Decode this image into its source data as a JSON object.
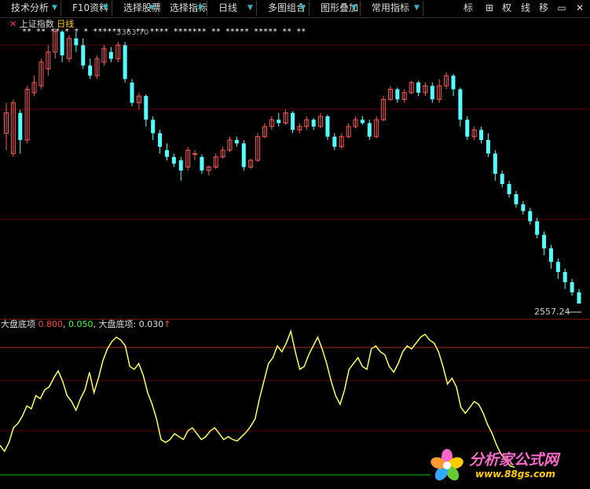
{
  "toolbar": {
    "items": [
      {
        "label": "技术分析",
        "arrow": true
      },
      {
        "label": "F10资料",
        "arrow": false
      },
      {
        "label": "选择股票",
        "arrow": false
      },
      {
        "label": "选择指标",
        "arrow": false
      },
      {
        "label": "日线",
        "arrow": true
      },
      {
        "label": "多图组合",
        "arrow": true
      },
      {
        "label": "图形叠加",
        "arrow": false
      },
      {
        "label": "常用指标",
        "arrow": true
      }
    ],
    "right_buttons": [
      "标",
      "权",
      "线",
      "移"
    ]
  },
  "main_panel": {
    "index_name": "上证指数",
    "period": "日线",
    "high_label": "3363.70",
    "low_label": "2557.24"
  },
  "sub_panel": {
    "indicator_name": "大盘底项",
    "level_high": "0.800",
    "level_low": "0.050",
    "value_label": "大盘底项",
    "value": "0.030"
  },
  "watermark": {
    "brand": "分析家公式网",
    "url": "www.88gs.com"
  },
  "colors": {
    "up": "#ff5555",
    "down": "#54ffff",
    "indicator": "#ffff55",
    "ref_red": "#a52a2a",
    "ref_green": "#00cc00",
    "accent_text_red": "#ff4444",
    "accent_text_green": "#44ff44"
  },
  "chart_data": [
    {
      "type": "candlestick",
      "title": "上证指数 日线",
      "ylim": [
        2520,
        3370
      ],
      "candles": [
        [
          3060,
          3120,
          3010,
          3150
        ],
        [
          3000,
          3150,
          2990,
          3160
        ],
        [
          3120,
          3040,
          3000,
          3130
        ],
        [
          3040,
          3190,
          3030,
          3200
        ],
        [
          3180,
          3210,
          3170,
          3230
        ],
        [
          3200,
          3270,
          3190,
          3280
        ],
        [
          3250,
          3300,
          3230,
          3320
        ],
        [
          3300,
          3360,
          3280,
          3370
        ],
        [
          3360,
          3290,
          3270,
          3365
        ],
        [
          3280,
          3340,
          3270,
          3350
        ],
        [
          3340,
          3320,
          3300,
          3360
        ],
        [
          3320,
          3260,
          3250,
          3340
        ],
        [
          3260,
          3230,
          3220,
          3280
        ],
        [
          3230,
          3280,
          3220,
          3290
        ],
        [
          3270,
          3310,
          3260,
          3320
        ],
        [
          3300,
          3280,
          3270,
          3315
        ],
        [
          3280,
          3320,
          3270,
          3330
        ],
        [
          3320,
          3220,
          3210,
          3330
        ],
        [
          3210,
          3150,
          3140,
          3220
        ],
        [
          3150,
          3170,
          3130,
          3180
        ],
        [
          3170,
          3100,
          3080,
          3175
        ],
        [
          3100,
          3060,
          3040,
          3110
        ],
        [
          3060,
          3020,
          3000,
          3070
        ],
        [
          3010,
          2990,
          2980,
          3030
        ],
        [
          2990,
          2970,
          2960,
          3000
        ],
        [
          2980,
          2950,
          2920,
          2990
        ],
        [
          2960,
          3010,
          2950,
          3020
        ],
        [
          3000,
          3000,
          2980,
          3010
        ],
        [
          2990,
          2950,
          2940,
          2998
        ],
        [
          2950,
          2960,
          2935,
          2965
        ],
        [
          2960,
          2990,
          2955,
          3000
        ],
        [
          2990,
          3010,
          2985,
          3020
        ],
        [
          3010,
          3040,
          3005,
          3050
        ],
        [
          3040,
          3030,
          3020,
          3050
        ],
        [
          3030,
          2960,
          2950,
          3040
        ],
        [
          2960,
          2980,
          2955,
          2985
        ],
        [
          2980,
          3050,
          2975,
          3060
        ],
        [
          3050,
          3080,
          3045,
          3090
        ],
        [
          3080,
          3100,
          3070,
          3110
        ],
        [
          3100,
          3090,
          3080,
          3120
        ],
        [
          3090,
          3120,
          3085,
          3130
        ],
        [
          3120,
          3070,
          3060,
          3125
        ],
        [
          3070,
          3080,
          3060,
          3090
        ],
        [
          3080,
          3100,
          3070,
          3110
        ],
        [
          3100,
          3080,
          3070,
          3105
        ],
        [
          3080,
          3110,
          3075,
          3120
        ],
        [
          3110,
          3050,
          3040,
          3115
        ],
        [
          3050,
          3020,
          3010,
          3060
        ],
        [
          3020,
          3050,
          3015,
          3060
        ],
        [
          3050,
          3080,
          3045,
          3090
        ],
        [
          3080,
          3100,
          3075,
          3110
        ],
        [
          3100,
          3090,
          3085,
          3110
        ],
        [
          3090,
          3050,
          3040,
          3100
        ],
        [
          3050,
          3100,
          3045,
          3110
        ],
        [
          3100,
          3160,
          3095,
          3170
        ],
        [
          3160,
          3190,
          3155,
          3200
        ],
        [
          3190,
          3160,
          3150,
          3195
        ],
        [
          3160,
          3180,
          3150,
          3190
        ],
        [
          3180,
          3210,
          3175,
          3215
        ],
        [
          3210,
          3180,
          3170,
          3215
        ],
        [
          3180,
          3200,
          3170,
          3210
        ],
        [
          3200,
          3160,
          3150,
          3210
        ],
        [
          3160,
          3200,
          3150,
          3220
        ],
        [
          3200,
          3230,
          3190,
          3240
        ],
        [
          3230,
          3190,
          3170,
          3235
        ],
        [
          3190,
          3100,
          3080,
          3195
        ],
        [
          3100,
          3050,
          3040,
          3110
        ],
        [
          3050,
          3070,
          3040,
          3080
        ],
        [
          3070,
          3040,
          3030,
          3080
        ],
        [
          3040,
          3000,
          2990,
          3060
        ],
        [
          3000,
          2940,
          2920,
          3010
        ],
        [
          2940,
          2910,
          2900,
          2950
        ],
        [
          2910,
          2880,
          2870,
          2920
        ],
        [
          2880,
          2850,
          2840,
          2890
        ],
        [
          2850,
          2830,
          2820,
          2860
        ],
        [
          2830,
          2800,
          2790,
          2840
        ],
        [
          2800,
          2760,
          2750,
          2810
        ],
        [
          2760,
          2720,
          2700,
          2770
        ],
        [
          2720,
          2680,
          2660,
          2730
        ],
        [
          2680,
          2650,
          2630,
          2690
        ],
        [
          2650,
          2620,
          2600,
          2660
        ],
        [
          2620,
          2590,
          2580,
          2630
        ],
        [
          2590,
          2557,
          2557,
          2600
        ]
      ]
    },
    {
      "type": "line",
      "title": "大盘底项",
      "ylim": [
        0,
        1
      ],
      "reference_lines": [
        0.8,
        0.05
      ],
      "series": [
        {
          "name": "大盘底项",
          "values": [
            0.18,
            0.14,
            0.2,
            0.3,
            0.33,
            0.38,
            0.45,
            0.43,
            0.52,
            0.5,
            0.56,
            0.58,
            0.64,
            0.69,
            0.62,
            0.52,
            0.48,
            0.42,
            0.5,
            0.56,
            0.68,
            0.54,
            0.64,
            0.76,
            0.84,
            0.89,
            0.92,
            0.9,
            0.86,
            0.72,
            0.7,
            0.74,
            0.66,
            0.54,
            0.46,
            0.36,
            0.22,
            0.2,
            0.22,
            0.26,
            0.24,
            0.22,
            0.28,
            0.3,
            0.26,
            0.22,
            0.24,
            0.28,
            0.3,
            0.26,
            0.22,
            0.24,
            0.22,
            0.21,
            0.24,
            0.27,
            0.31,
            0.36,
            0.5,
            0.62,
            0.74,
            0.78,
            0.86,
            0.82,
            0.88,
            0.96,
            0.82,
            0.7,
            0.72,
            0.8,
            0.86,
            0.92,
            0.84,
            0.74,
            0.62,
            0.52,
            0.46,
            0.56,
            0.7,
            0.74,
            0.78,
            0.72,
            0.7,
            0.84,
            0.86,
            0.82,
            0.8,
            0.72,
            0.68,
            0.74,
            0.82,
            0.86,
            0.84,
            0.88,
            0.92,
            0.94,
            0.9,
            0.88,
            0.82,
            0.72,
            0.6,
            0.64,
            0.58,
            0.44,
            0.4,
            0.44,
            0.48,
            0.46,
            0.4,
            0.32,
            0.26,
            0.18,
            0.12,
            0.08,
            0.04,
            0.03
          ]
        }
      ]
    }
  ]
}
